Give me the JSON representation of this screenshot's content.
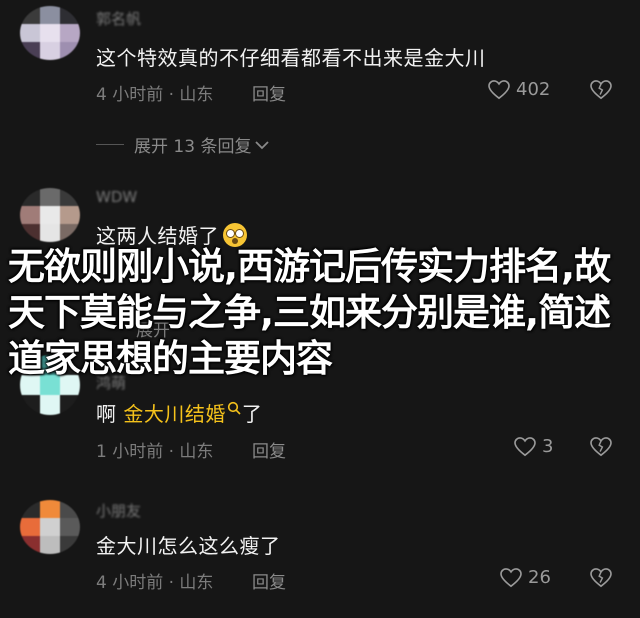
{
  "comments": [
    {
      "username": "郭名帆",
      "text": "这个特效真的不仔细看都看不出来是金大川",
      "time_location": "4 小时前 · 山东",
      "reply_label": "回复",
      "likes": "402",
      "avatar_colors": [
        "#3b3b3b",
        "#8b8fa0",
        "#2e2e33",
        "#c9c6d6",
        "#e7e0ee",
        "#b7a7c4",
        "#4a3f55",
        "#d8d0e2",
        "#9e8fb0"
      ]
    },
    {
      "username": "WDW",
      "text": "这两人结婚了",
      "avatar_colors": [
        "#2a2a2a",
        "#6a6a6a",
        "#3a3a3a",
        "#a07c78",
        "#e9e9e9",
        "#b59a8c",
        "#4c3030",
        "#e5e5e5",
        "#7a6a64"
      ]
    },
    {
      "username": "鸿萌",
      "text_prefix": "啊 ",
      "text_highlight": "金大川结婚",
      "text_suffix": "了",
      "time_location": "1 小时前 · 山东",
      "reply_label": "回复",
      "likes": "3",
      "avatar_colors": [
        "#1d1d1d",
        "#3d8f8a",
        "#1d1d1d",
        "#dff7f4",
        "#79e0d4",
        "#dff7f4",
        "#1d1d1d",
        "#dff7f4",
        "#1d1d1d"
      ]
    },
    {
      "username": "小朋友",
      "text": "金大川怎么这么瘦了",
      "time_location": "4 小时前 · 山东",
      "reply_label": "回复",
      "likes": "26",
      "avatar_colors": [
        "#2b2b2b",
        "#f08a3a",
        "#4a4a4a",
        "#e86c3a",
        "#d0d0d0",
        "#5a5a5a",
        "#8a2f2f",
        "#bdbdbd",
        "#3a3a3a"
      ]
    }
  ],
  "expand_replies": "展开 13 条回复",
  "partial_meta": "展开",
  "overlay_text": "无欲则刚小说,西游记后传实力排名,故天下莫能与之争,三如来分别是谁,简述道家思想的主要内容"
}
